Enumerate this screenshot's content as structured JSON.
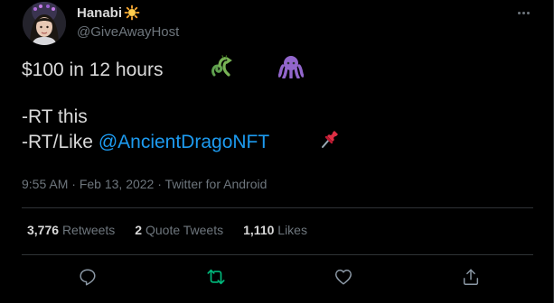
{
  "author": {
    "display_name": "Hanabi",
    "handle": "@GiveAwayHost"
  },
  "tweet": {
    "line1_text": "$100 in 12 hours",
    "line2_text": "-RT this",
    "line3_prefix": "-RT/Like ",
    "mention": "@AncientDragoNFT",
    "emojis": [
      "dragon-emoji",
      "octopus-emoji",
      "pushpin-emoji"
    ]
  },
  "meta": {
    "time": "9:55 AM",
    "separator": " · ",
    "date": "Feb 13, 2022",
    "source": "Twitter for Android"
  },
  "stats": {
    "retweets_count": "3,776",
    "retweets_label": "Retweets",
    "quotes_count": "2",
    "quotes_label": "Quote Tweets",
    "likes_count": "1,110",
    "likes_label": "Likes"
  },
  "colors": {
    "background": "#000000",
    "text": "#d9d9d9",
    "secondary": "#6e767d",
    "link": "#1d9bf0",
    "retweet_active": "#00ba7c",
    "divider": "#2f3336"
  },
  "icons": [
    "reply-icon",
    "retweet-icon",
    "like-icon",
    "share-icon",
    "more-icon"
  ]
}
